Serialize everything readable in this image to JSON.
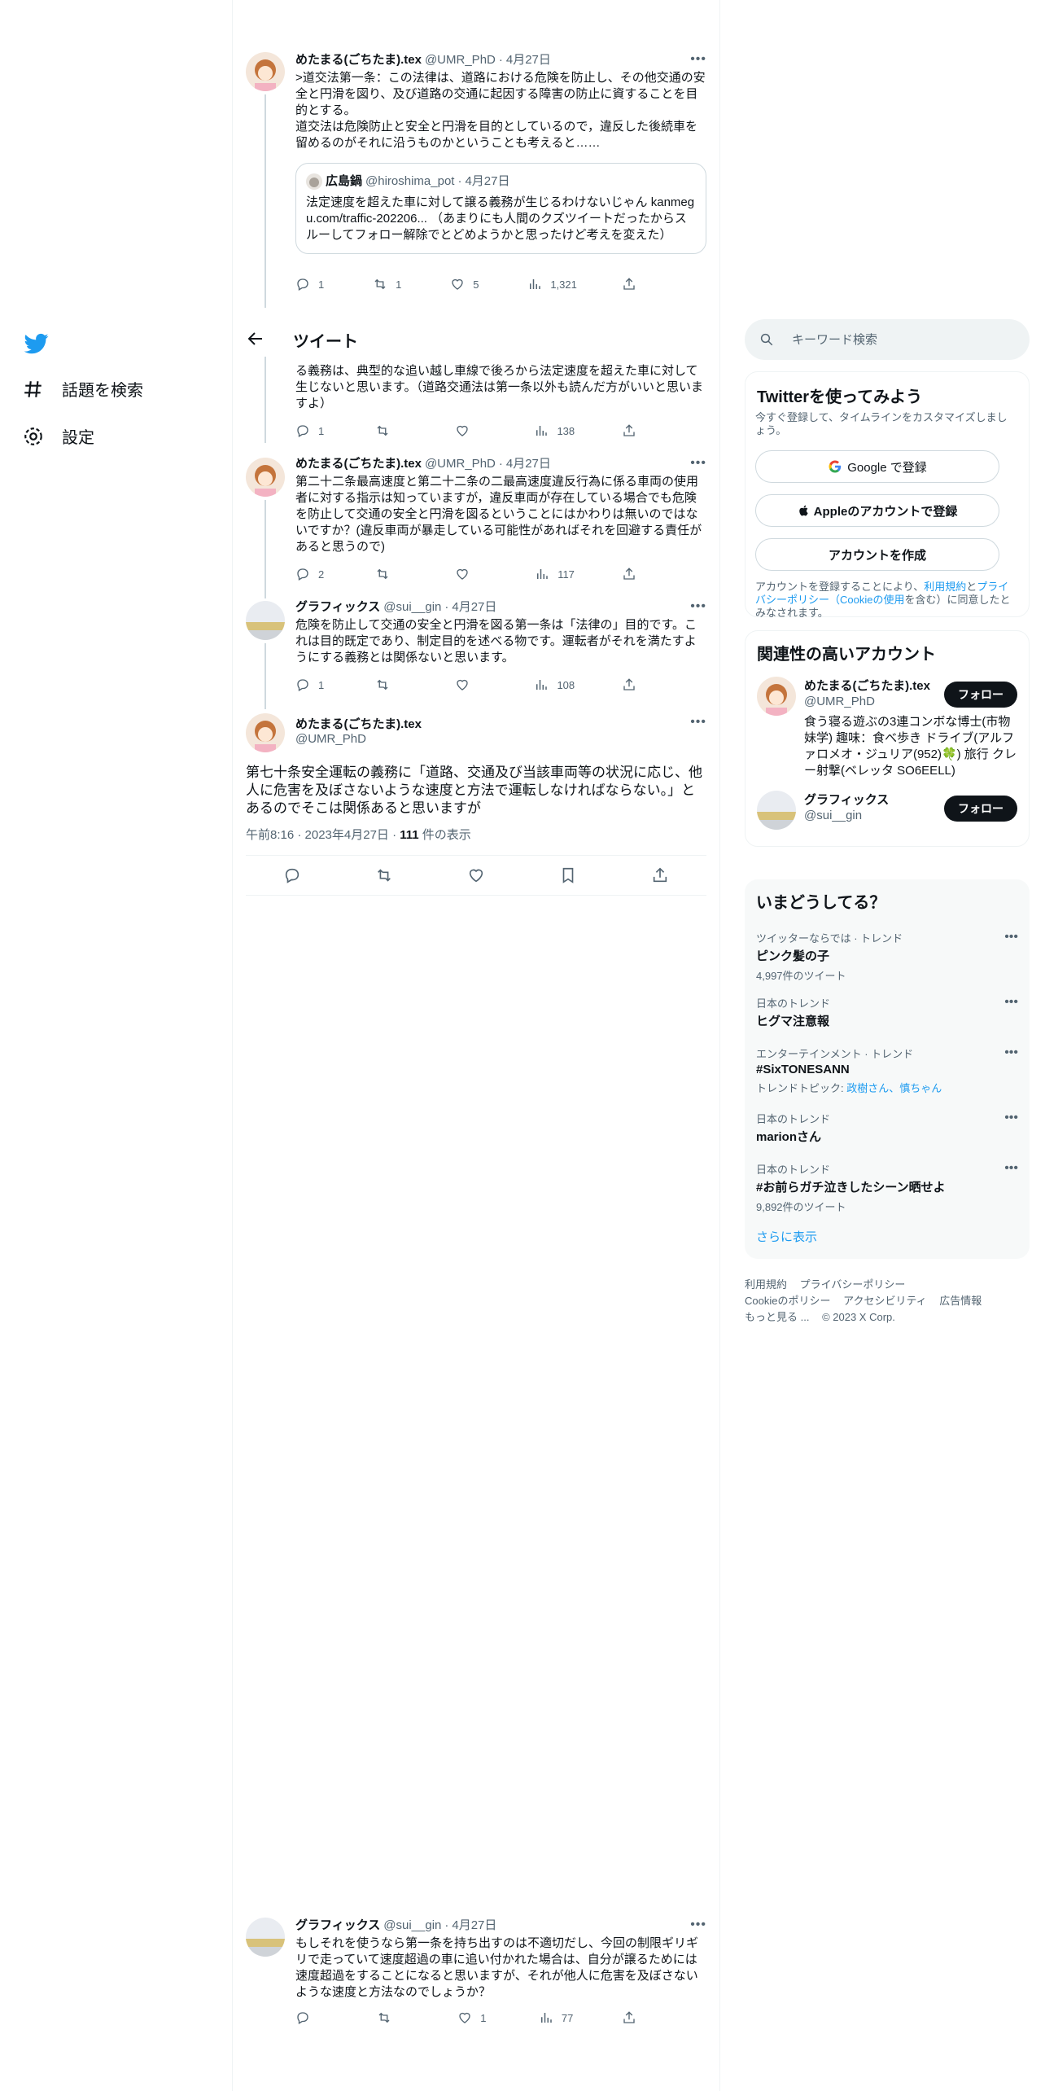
{
  "nav": {
    "explore_label": "話題を検索",
    "settings_label": "設定"
  },
  "header": {
    "title": "ツイート"
  },
  "tweets": {
    "t1": {
      "name": "めたまる(ごちたま).tex",
      "handle": "@UMR_PhD",
      "time": "4月27日",
      "text": ">道交法第一条：この法律は、道路における危険を防止し、その他交通の安全と円滑を図り、及び道路の交通に起因する障害の防止に資することを目的とする。\n道交法は危険防止と安全と円滑を目的としているので，違反した後続車を留めるのがそれに沿うものかということも考えると……",
      "quote": {
        "name": "広島鍋",
        "handle": "@hiroshima_pot",
        "time": "4月27日",
        "text": "法定速度を超えた車に対して譲る義務が生じるわけないじゃん kanmegu.com/traffic-202206... （あまりにも人間のクズツイートだったからスルーしてフォロー解除でとどめようかと思ったけど考えを変えた）"
      },
      "replies": "1",
      "retweets": "1",
      "likes": "5",
      "views": "1,321"
    },
    "t2": {
      "text": "る義務は、典型的な追い越し車線で後ろから法定速度を超えた車に対して生じないと思います。（道路交通法は第一条以外も読んだ方がいいと思いますよ）",
      "replies": "1",
      "retweets": "",
      "likes": "",
      "views": "138"
    },
    "t3": {
      "name": "めたまる(ごちたま).tex",
      "handle": "@UMR_PhD",
      "time": "4月27日",
      "text": "第二十二条最高速度と第二十二条の二最高速度違反行為に係る車両の使用者に対する指示は知っていますが，違反車両が存在している場合でも危険を防止して交通の安全と円滑を図るということにはかわりは無いのではないですか？(違反車両が暴走している可能性があればそれを回避する責任があると思うので)",
      "replies": "2",
      "retweets": "",
      "likes": "",
      "views": "117"
    },
    "t4": {
      "name": "グラフィックス",
      "handle": "@sui__gin",
      "time": "4月27日",
      "text": "危険を防止して交通の安全と円滑を図る第一条は「法律の」目的です。これは目的既定であり、制定目的を述べる物です。運転者がそれを満たすようにする義務とは関係ないと思います。",
      "replies": "1",
      "retweets": "",
      "likes": "",
      "views": "108"
    },
    "main": {
      "name": "めたまる(ごちたま).tex",
      "handle": "@UMR_PhD",
      "text": "第七十条安全運転の義務に「道路、交通及び当該車両等の状況に応じ、他人に危害を及ぼさないような速度と方法で運転しなければならない。」とあるのでそこは関係あると思いますが",
      "meta_time": "午前8:16 · 2023年4月27日 · ",
      "meta_views": "111",
      "meta_views_label": " 件の表示"
    },
    "t6": {
      "name": "グラフィックス",
      "handle": "@sui__gin",
      "time": "4月27日",
      "text": "もしそれを使うなら第一条を持ち出すのは不適切だし、今回の制限ギリギリで走っていて速度超過の車に追い付かれた場合は、自分が譲るためには速度超過をすることになると思いますが、それが他人に危害を及ぼさないような速度と方法なのでしょうか？",
      "replies": "",
      "retweets": "",
      "likes": "1",
      "views": "77"
    }
  },
  "right": {
    "search_placeholder": "キーワード検索",
    "signup": {
      "title": "Twitterを使ってみよう",
      "subtitle": "今すぐ登録して、タイムラインをカスタマイズしましょう。",
      "google_label": "Google で登録",
      "apple_label": "Appleのアカウントで登録",
      "create_label": "アカウントを作成",
      "legal_1": "アカウントを登録することにより、",
      "legal_terms": "利用規約",
      "legal_2": "と",
      "legal_privacy": "プライバシーポリシー（Cookieの使用",
      "legal_3": "を含む）に同意したとみなされます。"
    },
    "related": {
      "title": "関連性の高いアカウント",
      "accounts": [
        {
          "name": "めたまる(ごちたま).tex",
          "handle": "@UMR_PhD",
          "bio": "食う寝る遊ぶの3連コンボな博士(市物妹学) 趣味：食べ歩き ドライブ(アルファロメオ・ジュリア(952)🍀) 旅行 クレー射撃(ベレッタ SO6EELL)",
          "follow": "フォロー"
        },
        {
          "name": "グラフィックス",
          "handle": "@sui__gin",
          "bio": "",
          "follow": "フォロー"
        }
      ]
    },
    "trends": {
      "title": "いまどうしてる？",
      "items": [
        {
          "category": "ツイッターならでは · トレンド",
          "name": "ピンク髪の子",
          "count": "4,997件のツイート"
        },
        {
          "category": "日本のトレンド",
          "name": "ヒグマ注意報",
          "count": ""
        },
        {
          "category": "エンターテインメント · トレンド",
          "name": "#SixTONESANN",
          "count_prefix": "トレンドトピック: ",
          "count_link": "政樹さん、慎ちゃん"
        },
        {
          "category": "日本のトレンド",
          "name": "marionさん",
          "count": ""
        },
        {
          "category": "日本のトレンド",
          "name": "#お前らガチ泣きしたシーン晒せよ",
          "count": "9,892件のツイート"
        }
      ],
      "show_more": "さらに表示"
    },
    "footer": {
      "terms": "利用規約",
      "privacy": "プライバシーポリシー",
      "cookie": "Cookieのポリシー",
      "accessibility": "アクセシビリティ",
      "ads": "広告情報",
      "more": "もっと見る ...",
      "copyright": "© 2023 X Corp."
    }
  },
  "colors": {
    "accent": "#1d9bf0",
    "text": "#0f1419",
    "muted": "#536471",
    "border": "#eff3f4"
  }
}
